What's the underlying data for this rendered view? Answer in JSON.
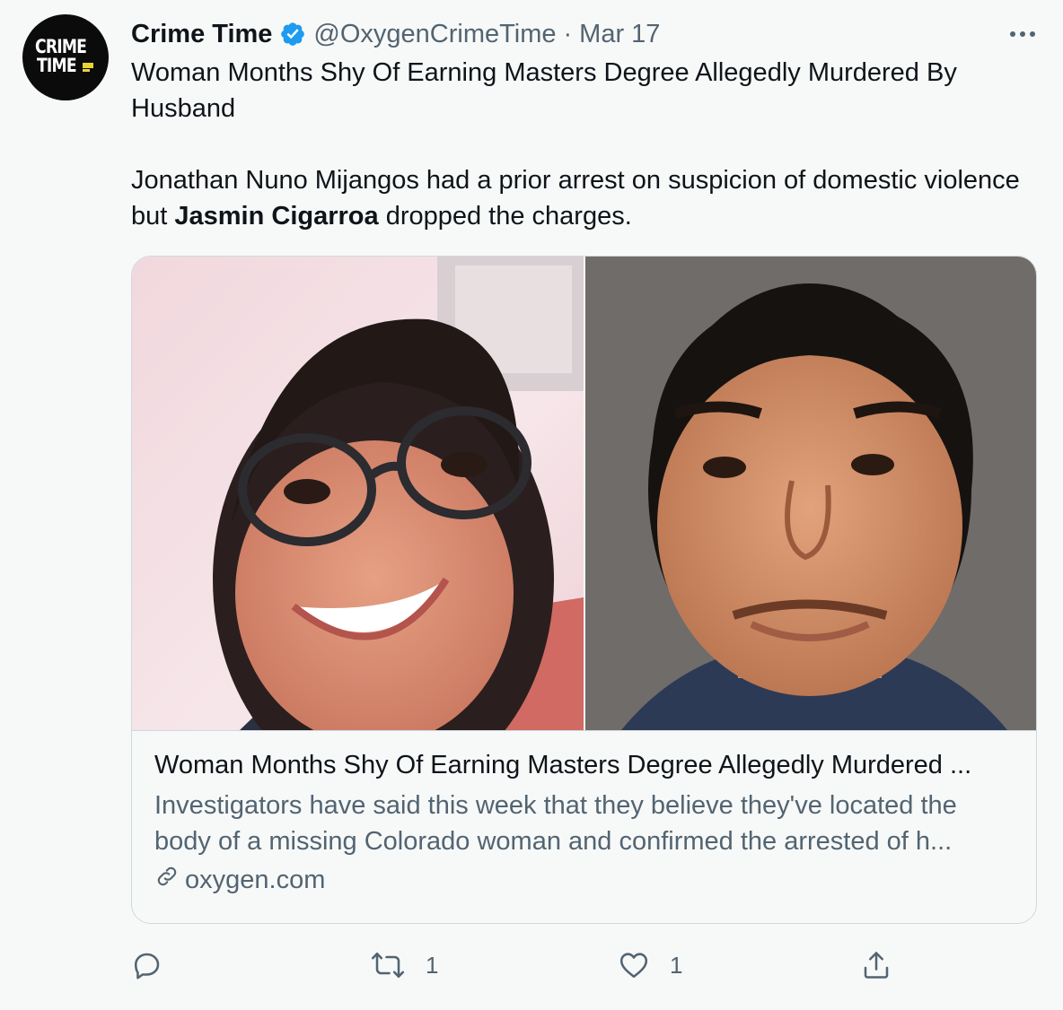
{
  "tweet": {
    "author_name": "Crime Time",
    "handle": "@OxygenCrimeTime",
    "separator": "·",
    "date": "Mar 17",
    "avatar_line1": "CRIME",
    "avatar_line2": "TIME",
    "text_line1": "Woman Months Shy Of Earning Masters Degree Allegedly Murdered By Husband",
    "text_p2_before": "Jonathan Nuno Mijangos had a prior arrest on suspicion of domestic violence but ",
    "text_p2_bold": "Jasmin Cigarroa",
    "text_p2_after": " dropped the charges."
  },
  "card": {
    "title": "Woman Months Shy Of Earning Masters Degree Allegedly Murdered ...",
    "description": "Investigators have said this week that they believe they've located the body of a missing Colorado woman and confirmed the arrested of h...",
    "domain": "oxygen.com"
  },
  "actions": {
    "reply_count": "",
    "retweet_count": "1",
    "like_count": "1"
  },
  "colors": {
    "verified": "#1d9bf0",
    "muted": "#536471",
    "border": "#cfd9de",
    "background": "#f7f9f9"
  },
  "icons": [
    "verified-badge-icon",
    "more-icon",
    "reply-icon",
    "retweet-icon",
    "like-icon",
    "share-icon",
    "link-icon"
  ]
}
